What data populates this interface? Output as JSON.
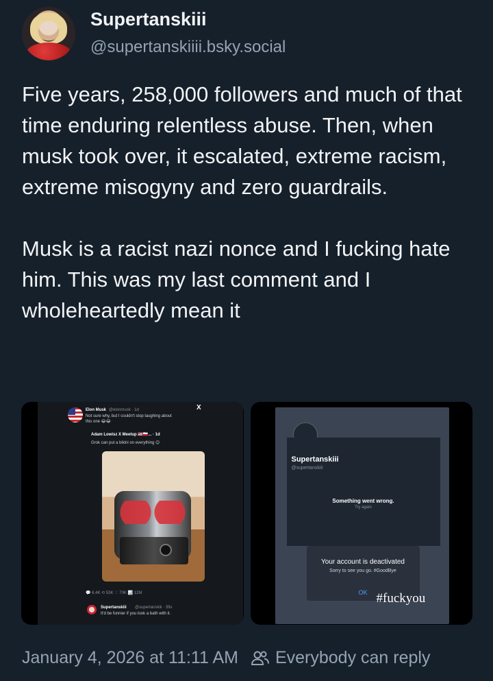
{
  "author": {
    "display_name": "Supertanskiii",
    "handle": "@supertanskiiii.bsky.social"
  },
  "post": {
    "text": "Five years, 258,000 followers and much of that time enduring relentless abuse. Then, when musk took over, it escalated, extreme racism, extreme misogyny and zero guardrails.\n\nMusk is a racist nazi nonce and I fucking hate him. This was my last comment and I wholeheartedly mean it"
  },
  "embed_left": {
    "author_line": "Elon Musk",
    "handle_time": "@elonmusk · 1d",
    "x_logo": "X",
    "text1": "Not sure why, but I couldn't stop laughing about",
    "text2": "this one 😂😂",
    "quoted_author": "Adam Lowisz X Meetup 🇺🇸🇵🇱... · 1d",
    "quoted_text": "Grok can put a bikini on everything 😊",
    "stats": "💬 6.4K   ⟲ 53K   ♡ 70K   📊 12M",
    "reply_author": "Supertanskiii",
    "reply_handle": "@supertanskiii · 39s",
    "reply_text": "It'd be funnier if you took a bath with it."
  },
  "embed_right": {
    "profile_name": "Supertanskiii",
    "profile_handle": "@supertanskiii",
    "error": "Something went wrong.",
    "retry": "Try again",
    "dialog_title": "Your account is deactivated",
    "dialog_sub": "Sorry to see you go. #GoodBye",
    "ok": "OK",
    "hashtag": "#fuckyou"
  },
  "footer": {
    "timestamp": "January 4, 2026 at 11:11 AM",
    "reply_setting": "Everybody can reply"
  }
}
